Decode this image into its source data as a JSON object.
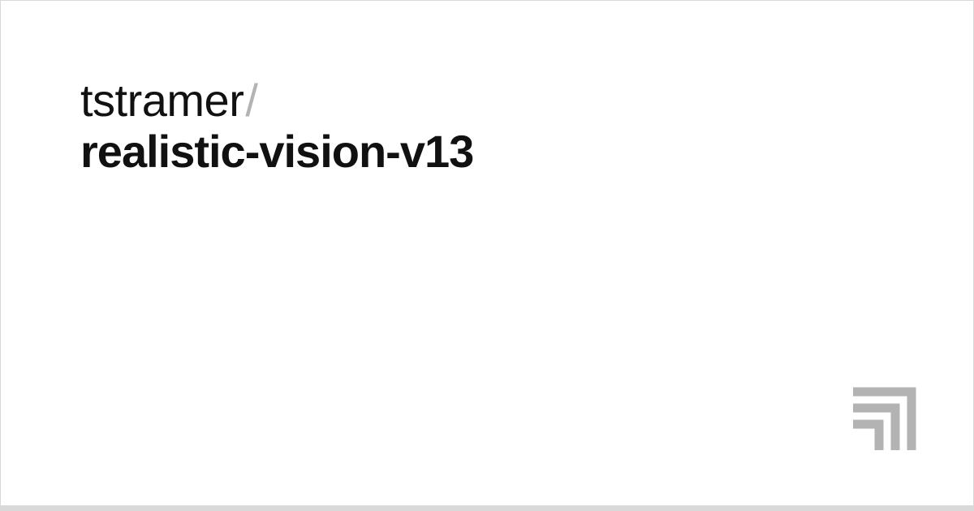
{
  "heading": {
    "owner": "tstramer",
    "separator": "/",
    "name": "realistic-vision-v13"
  },
  "colors": {
    "owner_text": "#111111",
    "separator_text": "#b3b3b3",
    "name_text": "#111111",
    "card_border": "#d9d9d9",
    "card_bg": "#ffffff",
    "logo_stroke": "#b3b3b3"
  }
}
